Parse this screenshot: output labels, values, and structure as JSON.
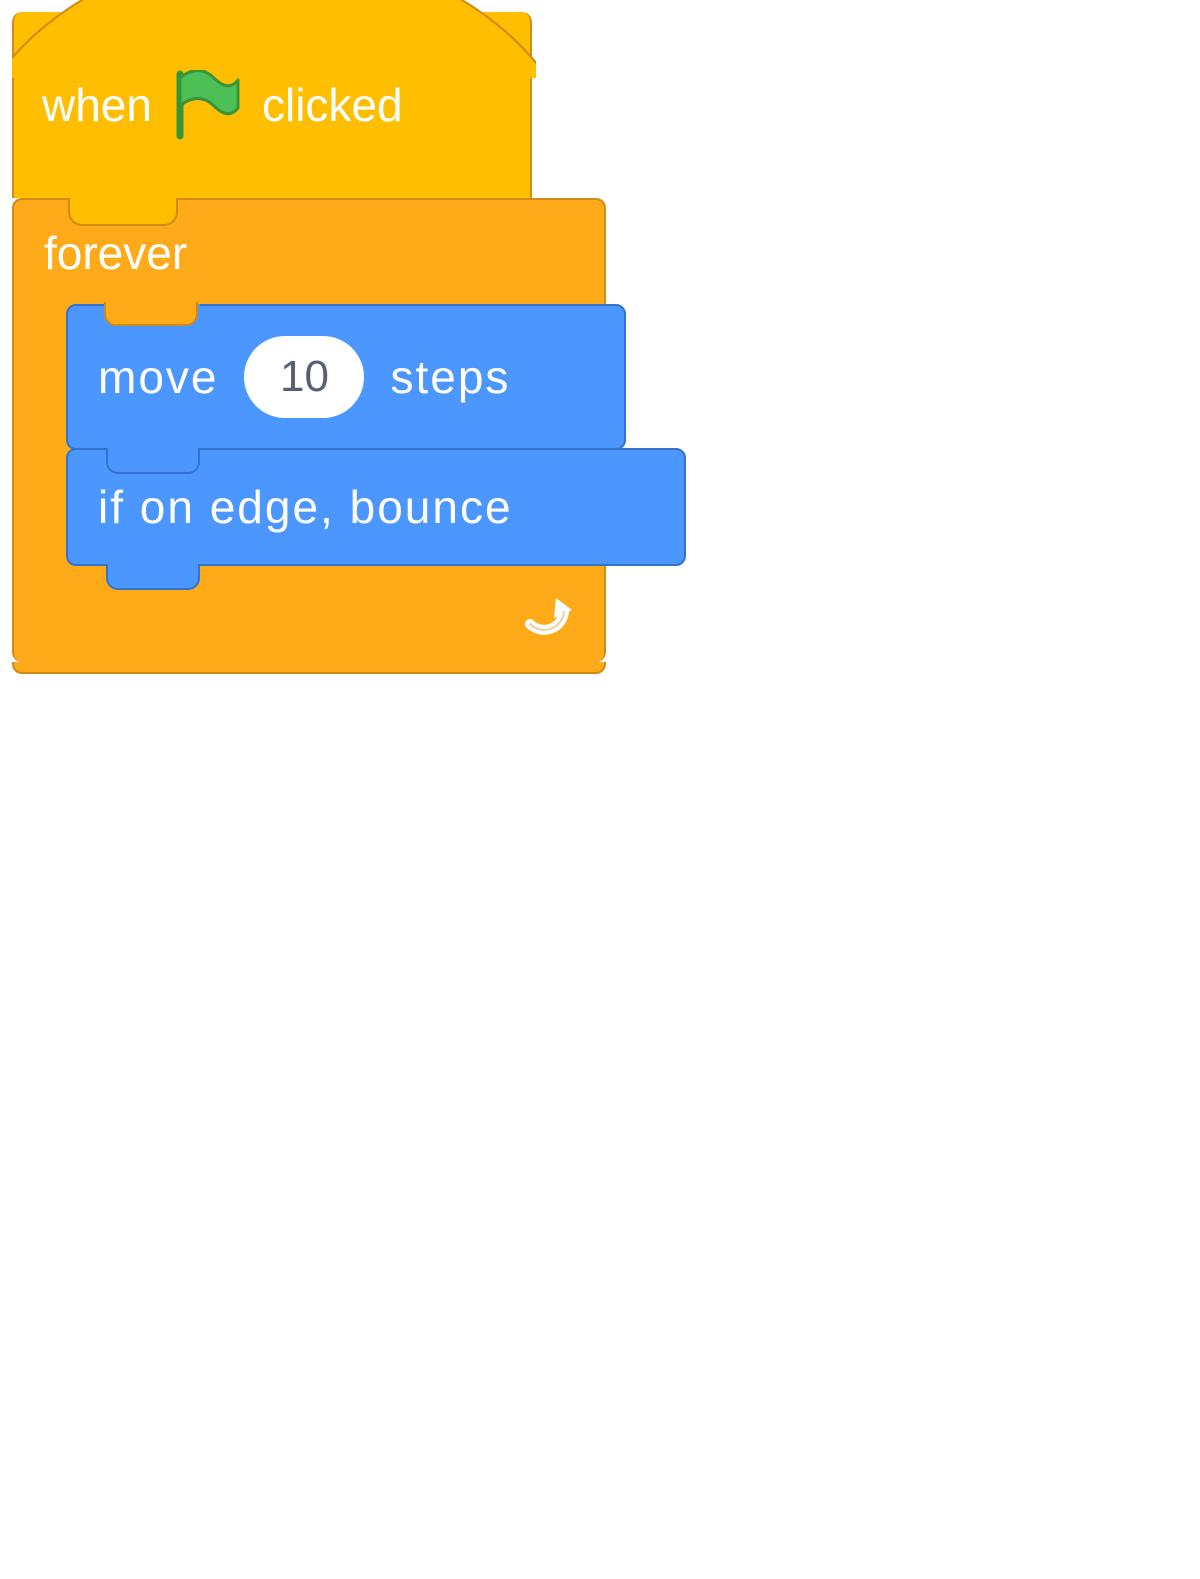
{
  "script": {
    "hat": {
      "text_before": "when",
      "text_after": "clicked",
      "icon": "green-flag-icon"
    },
    "forever": {
      "label": "forever",
      "loop_icon": "loop-arrow-icon",
      "children": [
        {
          "kind": "move",
          "text_before": "move",
          "value": "10",
          "text_after": "steps"
        },
        {
          "kind": "bounce",
          "label": "if on edge, bounce"
        }
      ]
    }
  },
  "colors": {
    "events": "#ffbf00",
    "events_border": "#cf8b17",
    "control": "#ffab19",
    "control_border": "#cf8b17",
    "motion": "#4c97ff",
    "motion_border": "#3373cc",
    "flag_green": "#4cbf56",
    "flag_green_dark": "#389438",
    "input_text": "#575e75"
  }
}
